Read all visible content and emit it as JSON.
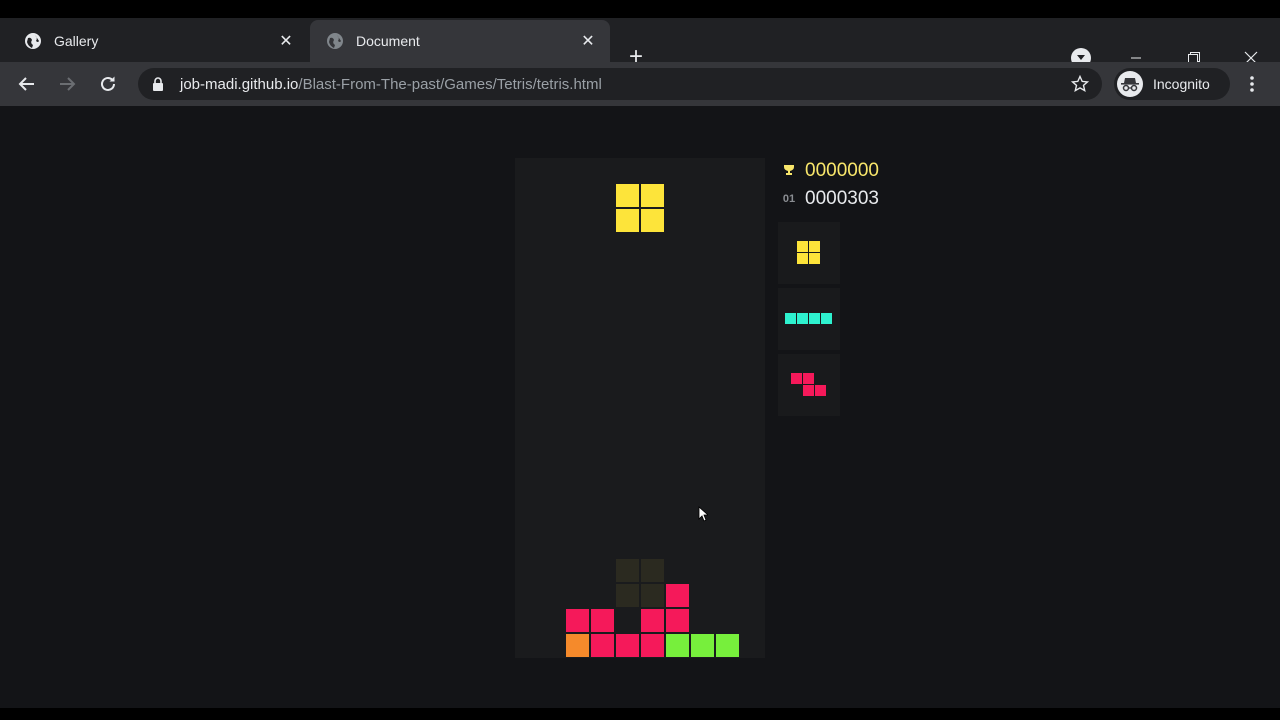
{
  "browser": {
    "tabs": [
      {
        "title": "Gallery",
        "active": false,
        "favicon": "globe-icon"
      },
      {
        "title": "Document",
        "active": true,
        "favicon": "globe-icon"
      }
    ],
    "url_host": "job-madi.github.io",
    "url_path": "/Blast-From-The-past/Games/Tetris/tetris.html",
    "incognito_label": "Incognito"
  },
  "game": {
    "high_score": "0000000",
    "score_prefix": "01",
    "score": "0000303",
    "colors": {
      "O": "#fde43a",
      "I": "#2ef2cf",
      "Z": "#f5195a",
      "L": "#f58a2b",
      "S": "#77ef3c",
      "ghost": "#2b2a20",
      "trophy": "#f8e66b"
    },
    "board": {
      "cols": 10,
      "rows": 20,
      "active_piece": {
        "type": "O",
        "cells": [
          [
            4,
            1
          ],
          [
            5,
            1
          ],
          [
            4,
            2
          ],
          [
            5,
            2
          ]
        ]
      },
      "ghost_cells": [
        [
          4,
          16
        ],
        [
          5,
          16
        ],
        [
          4,
          17
        ],
        [
          5,
          17
        ]
      ],
      "settled": [
        {
          "c": 6,
          "r": 17,
          "type": "Z"
        },
        {
          "c": 2,
          "r": 18,
          "type": "Z"
        },
        {
          "c": 3,
          "r": 18,
          "type": "Z"
        },
        {
          "c": 5,
          "r": 18,
          "type": "Z"
        },
        {
          "c": 6,
          "r": 18,
          "type": "Z"
        },
        {
          "c": 2,
          "r": 19,
          "type": "L"
        },
        {
          "c": 3,
          "r": 19,
          "type": "Z"
        },
        {
          "c": 4,
          "r": 19,
          "type": "Z"
        },
        {
          "c": 5,
          "r": 19,
          "type": "Z"
        },
        {
          "c": 6,
          "r": 19,
          "type": "S"
        },
        {
          "c": 7,
          "r": 19,
          "type": "S"
        },
        {
          "c": 8,
          "r": 19,
          "type": "S"
        }
      ]
    },
    "next_queue": [
      {
        "type": "O",
        "cells": [
          [
            0,
            0
          ],
          [
            1,
            0
          ],
          [
            0,
            1
          ],
          [
            1,
            1
          ]
        ]
      },
      {
        "type": "I",
        "cells": [
          [
            0,
            0
          ],
          [
            1,
            0
          ],
          [
            2,
            0
          ],
          [
            3,
            0
          ]
        ]
      },
      {
        "type": "Z",
        "cells": [
          [
            0,
            0
          ],
          [
            1,
            0
          ],
          [
            1,
            1
          ],
          [
            2,
            1
          ]
        ]
      }
    ]
  }
}
